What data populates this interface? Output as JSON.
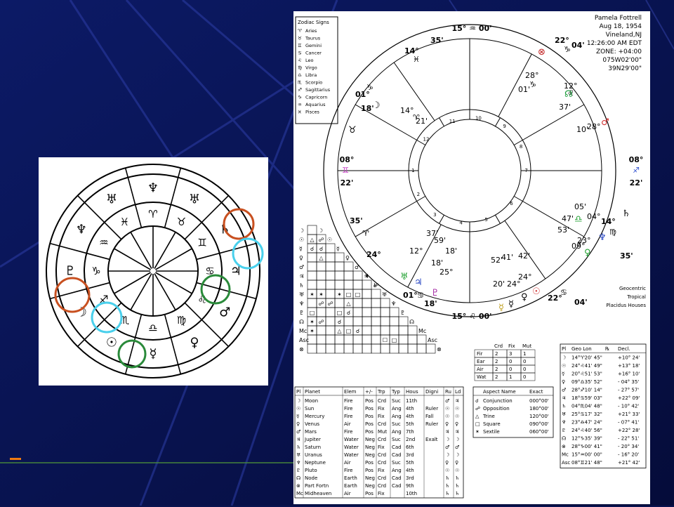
{
  "chart": {
    "name": "Pamela Fottrell",
    "date": "Aug 18, 1954",
    "place": "Vineland,NJ",
    "time": "12:26:00 AM EDT",
    "zone": "ZONE: +04:00",
    "lon": "075W02'00\"",
    "lat": "39N29'00\""
  },
  "legend": {
    "title": "Zodiac Signs",
    "signs": [
      {
        "glyph": "♈",
        "name": "Aries"
      },
      {
        "glyph": "♉",
        "name": "Taurus"
      },
      {
        "glyph": "♊",
        "name": "Gemini"
      },
      {
        "glyph": "♋",
        "name": "Cancer"
      },
      {
        "glyph": "♌",
        "name": "Leo"
      },
      {
        "glyph": "♍",
        "name": "Virgo"
      },
      {
        "glyph": "♎",
        "name": "Libra"
      },
      {
        "glyph": "♏",
        "name": "Scorpio"
      },
      {
        "glyph": "♐",
        "name": "Sagittarius"
      },
      {
        "glyph": "♑",
        "name": "Capricorn"
      },
      {
        "glyph": "♒",
        "name": "Aquarius"
      },
      {
        "glyph": "♓",
        "name": "Pisces"
      }
    ]
  },
  "footer_note": [
    "Geocentric",
    "Tropical",
    "Placidus Houses"
  ],
  "wheel_labels": {
    "mc_deg": "15°",
    "mc_sign": "♒",
    "mc_min": "00'",
    "ic_deg": "15°",
    "ic_sign": "♌",
    "ic_min": "00'",
    "asc_deg": "08°",
    "asc_sign": "♊",
    "asc_min": "22'",
    "dsc_deg": "08°",
    "dsc_sign": "♐",
    "dsc_min": "22'"
  },
  "cusp_labels": [
    "14°",
    "♓",
    "35'",
    "22°",
    "♑",
    "04'",
    "01°",
    "♑",
    "18'",
    "35'",
    "♈",
    "24°",
    "01°",
    "♋",
    "18'",
    "22°",
    "♋",
    "04'",
    "14°",
    "♍",
    "35'",
    "35'",
    "♎",
    "24°"
  ],
  "planet_labels": [
    "28°",
    "♑",
    "01'",
    "12°",
    "♌",
    "37'",
    "10'",
    "28°",
    "14°",
    "♈",
    "21'",
    "05'",
    "04°",
    "47'",
    "23°",
    "53'",
    "09°",
    "37'",
    "59'",
    "12°",
    "18'",
    "18'",
    "25°",
    "52'",
    "41'",
    "42'",
    "24°",
    "20'",
    "24°"
  ],
  "house_numbers": [
    "1",
    "2",
    "3",
    "4",
    "5",
    "6",
    "7",
    "8",
    "9",
    "10",
    "11",
    "12"
  ],
  "element_table": {
    "headers": [
      "",
      "Crd",
      "Fix",
      "Mut"
    ],
    "rows": [
      [
        "Fir",
        "2",
        "3",
        "1"
      ],
      [
        "Ear",
        "2",
        "0",
        "0"
      ],
      [
        "Air",
        "2",
        "0",
        "0"
      ],
      [
        "Wat",
        "2",
        "1",
        "0"
      ]
    ]
  },
  "planet_table": {
    "headers": [
      "Pl",
      "Planet",
      "Elem",
      "+/-",
      "Trp",
      "Typ",
      "Hous",
      "Digni",
      "Ru",
      "Ld"
    ],
    "rows": [
      [
        "☽",
        "Moon",
        "Fire",
        "Pos",
        "Crd",
        "Suc",
        "11th",
        "",
        "♂",
        "♃"
      ],
      [
        "☉",
        "Sun",
        "Fire",
        "Pos",
        "Fix",
        "Ang",
        "4th",
        "Ruler",
        "☉",
        "☉"
      ],
      [
        "☿",
        "Mercury",
        "Fire",
        "Pos",
        "Fix",
        "Ang",
        "4th",
        "Fall",
        "☉",
        "☉"
      ],
      [
        "♀",
        "Venus",
        "Air",
        "Pos",
        "Crd",
        "Suc",
        "5th",
        "Ruler",
        "♀",
        "♀"
      ],
      [
        "♂",
        "Mars",
        "Fire",
        "Pos",
        "Mut",
        "Ang",
        "7th",
        "",
        "♃",
        "♃"
      ],
      [
        "♃",
        "Jupiter",
        "Water",
        "Neg",
        "Crd",
        "Suc",
        "2nd",
        "Exalt",
        "☽",
        "☽"
      ],
      [
        "♄",
        "Saturn",
        "Water",
        "Neg",
        "Fix",
        "Cad",
        "6th",
        "",
        "♂",
        "♂"
      ],
      [
        "♅",
        "Uranus",
        "Water",
        "Neg",
        "Crd",
        "Cad",
        "3rd",
        "",
        "☽",
        "☽"
      ],
      [
        "♆",
        "Neptune",
        "Air",
        "Pos",
        "Crd",
        "Suc",
        "5th",
        "",
        "♀",
        "♀"
      ],
      [
        "♇",
        "Pluto",
        "Fire",
        "Pos",
        "Fix",
        "Ang",
        "4th",
        "",
        "☉",
        "☉"
      ],
      [
        "☊",
        "Node",
        "Earth",
        "Neg",
        "Crd",
        "Cad",
        "3rd",
        "",
        "♄",
        "♄"
      ],
      [
        "⊗",
        "Part Fortn",
        "Earth",
        "Neg",
        "Crd",
        "Cad",
        "9th",
        "",
        "♄",
        "♄"
      ],
      [
        "Mc",
        "Midheaven",
        "Air",
        "Pos",
        "Fix",
        "",
        "10th",
        "",
        "♄",
        "♄"
      ]
    ]
  },
  "aspect_table": {
    "headers": [
      "Aspect Name",
      "Exact"
    ],
    "rows": [
      [
        "☌",
        "Conjunction",
        "000°00'"
      ],
      [
        "☍",
        "Opposition",
        "180°00'"
      ],
      [
        "△",
        "Trine",
        "120°00'"
      ],
      [
        "□",
        "Square",
        "090°00'"
      ],
      [
        "✶",
        "Sextile",
        "060°00'"
      ]
    ]
  },
  "geo_table": {
    "headers": [
      "Pl",
      "Geo Lon",
      "℞",
      "Decl."
    ],
    "rows": [
      [
        "☽",
        "14°♈20' 45\"",
        "",
        "+10° 24'"
      ],
      [
        "☉",
        "24°♌41' 49\"",
        "",
        "+13° 18'"
      ],
      [
        "☿",
        "20°♌51' 53\"",
        "",
        "+16° 10'"
      ],
      [
        "♀",
        "09°♎35' 52\"",
        "",
        "- 04° 35'"
      ],
      [
        "♂",
        "28°♐10' 14\"",
        "",
        "- 27° 57'"
      ],
      [
        "♃",
        "18°♋59' 03\"",
        "",
        "+22° 09'"
      ],
      [
        "♄",
        "04°♏04' 48\"",
        "",
        "- 10° 42'"
      ],
      [
        "♅",
        "25°♋17' 32\"",
        "",
        "+21° 33'"
      ],
      [
        "♆",
        "23°♎47' 24\"",
        "",
        "- 07° 41'"
      ],
      [
        "♇",
        "24°♌40' 56\"",
        "",
        "+22° 28'"
      ],
      [
        "☊",
        "12°♑35' 39\"",
        "",
        "- 22° 51'"
      ],
      [
        "⊗",
        "28°♑00' 41\"",
        "",
        "- 20° 34'"
      ],
      [
        "Mc",
        "15°♒00' 00\"",
        "",
        "- 16° 20'"
      ],
      [
        "Asc",
        "08°♊21' 48\"",
        "",
        "+21° 42'"
      ]
    ]
  },
  "aspect_grid_rows": [
    "☽",
    "☉",
    "☿",
    "♀",
    "♂",
    "♃",
    "♄",
    "♅",
    "♆",
    "♇",
    "☊",
    "Mc",
    "Asc",
    "⊗"
  ],
  "aspect_grid_cells": [
    [
      "△",
      "☍"
    ],
    [
      "☌",
      "☌"
    ],
    [
      "",
      "△"
    ],
    [],
    [
      "",
      "",
      "",
      "",
      "",
      "",
      "✶"
    ],
    [
      "",
      "",
      "",
      "",
      "",
      "",
      "",
      "☍"
    ],
    [
      "✶",
      "✶",
      "",
      "✶",
      "□",
      "□"
    ],
    [
      "",
      "☍",
      "☍",
      "",
      "△"
    ],
    [
      "□",
      "",
      "",
      "□",
      "☌"
    ],
    [
      "✶",
      "☍",
      "",
      "☌"
    ],
    [
      "✶",
      "",
      "",
      "△",
      "□",
      "☌"
    ],
    [
      "",
      "",
      "",
      "",
      "",
      "",
      "",
      "",
      "☐",
      "□"
    ]
  ],
  "left_chart_glyphs": [
    "♆",
    "♅",
    "♄",
    "♃",
    "♂",
    "♀",
    "☿",
    "☉",
    "☽",
    "♇",
    "♈",
    "♉",
    "♊",
    "♋",
    "♌",
    "♍",
    "♎",
    "♏",
    "♐",
    "♑",
    "♒",
    "♓"
  ]
}
